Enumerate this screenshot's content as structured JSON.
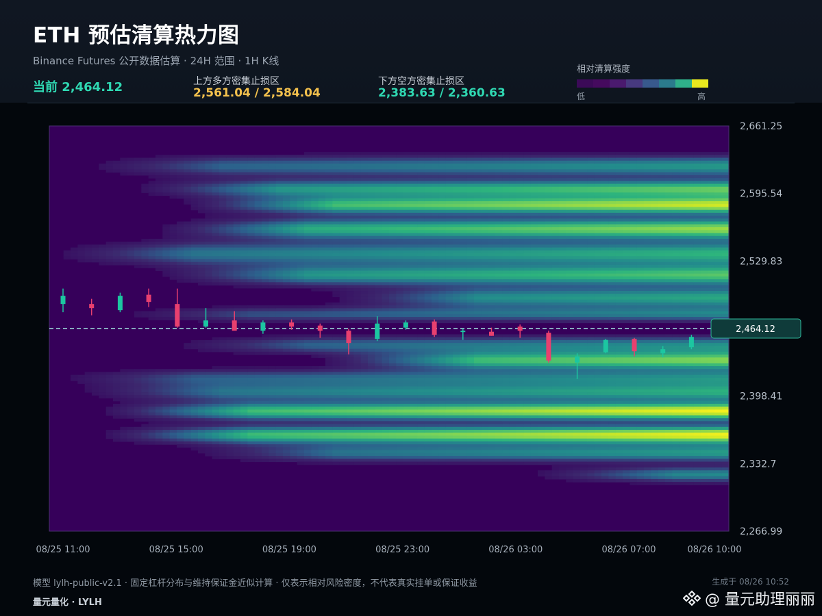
{
  "header": {
    "title": "ETH 预估清算热力图",
    "subtitle": "Binance Futures 公开数据估算 · 24H 范围 · 1H K线",
    "current_text": "当前 2,464.12",
    "upper_label": "上方多方密集止损区",
    "upper_value": "2,561.04 / 2,584.04",
    "lower_label": "下方空方密集止损区",
    "lower_value": "2,383.63 / 2,360.63"
  },
  "legend": {
    "title": "相对清算强度",
    "low": "低",
    "high": "高",
    "colors": [
      "#3b0a57",
      "#450a5e",
      "#4a1a6e",
      "#47397f",
      "#38598c",
      "#2b7b8d",
      "#2fb08a",
      "#e9e91f"
    ]
  },
  "footer": {
    "note": "模型 lylh-public-v2.1 · 固定杠杆分布与维持保证金近似计算 · 仅表示相对风险密度，不代表真实挂单或保证收益",
    "brand": "量元量化 · LYLH",
    "generated": "生成于 08/26 10:52",
    "watermark": "@ 量元助理丽丽",
    "watermark_icon": "binance-square-icon"
  },
  "colors": {
    "up": "#1cc6a1",
    "down": "#e8406f",
    "current_line": "#9fdfe0",
    "price_tag_bg": "#0f3b3a",
    "price_tag_border": "#2fb79a"
  },
  "chart_data": {
    "type": "heatmap",
    "title": "ETH 预估清算热力图",
    "ylim": [
      2266.99,
      2661.25
    ],
    "y_ticks": [
      2661.25,
      2595.54,
      2529.83,
      2464.12,
      2398.41,
      2332.7,
      2266.99
    ],
    "y_tick_labels": [
      "2,661.25",
      "2,595.54",
      "2,529.83",
      "2,464.12",
      "2,398.41",
      "2,332.7",
      "2,266.99"
    ],
    "x_ticks": [
      "08/25 11:00",
      "08/25 15:00",
      "08/25 19:00",
      "08/25 23:00",
      "08/26 03:00",
      "08/26 07:00",
      "08/26 10:00"
    ],
    "x_tick_positions": [
      0,
      4,
      8,
      12,
      16,
      20,
      23
    ],
    "current_price": 2464.12,
    "current_label": "2,464.12",
    "candles": [
      {
        "t": "08/25 11:00",
        "o": 2488,
        "c": 2496,
        "h": 2503,
        "l": 2480
      },
      {
        "t": "08/25 12:00",
        "o": 2488,
        "c": 2484,
        "h": 2493,
        "l": 2477
      },
      {
        "t": "08/25 13:00",
        "o": 2482,
        "c": 2496,
        "h": 2499,
        "l": 2480
      },
      {
        "t": "08/25 14:00",
        "o": 2497,
        "c": 2490,
        "h": 2503,
        "l": 2485
      },
      {
        "t": "08/25 15:00",
        "o": 2488,
        "c": 2466,
        "h": 2503,
        "l": 2465
      },
      {
        "t": "08/25 16:00",
        "o": 2466,
        "c": 2472,
        "h": 2484,
        "l": 2465
      },
      {
        "t": "08/25 17:00",
        "o": 2472,
        "c": 2462,
        "h": 2481,
        "l": 2465
      },
      {
        "t": "08/25 18:00",
        "o": 2462,
        "c": 2470,
        "h": 2472,
        "l": 2459
      },
      {
        "t": "08/25 19:00",
        "o": 2470,
        "c": 2466,
        "h": 2473,
        "l": 2463
      },
      {
        "t": "08/25 20:00",
        "o": 2467,
        "c": 2462,
        "h": 2469,
        "l": 2455
      },
      {
        "t": "08/25 21:00",
        "o": 2462,
        "c": 2450,
        "h": 2464,
        "l": 2439
      },
      {
        "t": "08/25 22:00",
        "o": 2454,
        "c": 2469,
        "h": 2476,
        "l": 2452
      },
      {
        "t": "08/25 23:00",
        "o": 2465,
        "c": 2470,
        "h": 2472,
        "l": 2463
      },
      {
        "t": "08/26 00:00",
        "o": 2471,
        "c": 2458,
        "h": 2473,
        "l": 2456
      },
      {
        "t": "08/26 01:00",
        "o": 2461,
        "c": 2462,
        "h": 2464,
        "l": 2453
      },
      {
        "t": "08/26 02:00",
        "o": 2461,
        "c": 2457,
        "h": 2465,
        "l": 2457
      },
      {
        "t": "08/26 03:00",
        "o": 2466,
        "c": 2462,
        "h": 2468,
        "l": 2455
      },
      {
        "t": "08/26 04:00",
        "o": 2460,
        "c": 2433,
        "h": 2462,
        "l": 2431
      },
      {
        "t": "08/26 05:00",
        "o": 2431,
        "c": 2437,
        "h": 2440,
        "l": 2415
      },
      {
        "t": "08/26 06:00",
        "o": 2441,
        "c": 2453,
        "h": 2454,
        "l": 2440
      },
      {
        "t": "08/26 07:00",
        "o": 2454,
        "c": 2442,
        "h": 2455,
        "l": 2437
      },
      {
        "t": "08/26 08:00",
        "o": 2440,
        "c": 2444,
        "h": 2447,
        "l": 2436
      },
      {
        "t": "08/26 09:00",
        "o": 2446,
        "c": 2456,
        "h": 2458,
        "l": 2444
      },
      {
        "t": "08/26 10:00",
        "o": 2458,
        "c": 2464.12,
        "h": 2465,
        "l": 2456
      }
    ],
    "bands": [
      {
        "center": 2622,
        "width": 7,
        "intensity": 0.55,
        "start": 2
      },
      {
        "center": 2600,
        "width": 6,
        "intensity": 0.75,
        "start": 4
      },
      {
        "center": 2584.04,
        "width": 6,
        "intensity": 0.92,
        "start": 6
      },
      {
        "center": 2561.04,
        "width": 7,
        "intensity": 0.85,
        "start": 5
      },
      {
        "center": 2537,
        "width": 8,
        "intensity": 0.65,
        "start": 1
      },
      {
        "center": 2516,
        "width": 7,
        "intensity": 0.72,
        "start": 5
      },
      {
        "center": 2494,
        "width": 7,
        "intensity": 0.6,
        "start": 11
      },
      {
        "center": 2478,
        "width": 5,
        "intensity": 0.45,
        "start": 3
      },
      {
        "center": 2448,
        "width": 6,
        "intensity": 0.5,
        "start": 5
      },
      {
        "center": 2433,
        "width": 6,
        "intensity": 0.8,
        "start": 11
      },
      {
        "center": 2416,
        "width": 6,
        "intensity": 0.5,
        "start": 1
      },
      {
        "center": 2402,
        "width": 6,
        "intensity": 0.6,
        "start": 2
      },
      {
        "center": 2383.63,
        "width": 6,
        "intensity": 1.0,
        "start": 3
      },
      {
        "center": 2360.63,
        "width": 6,
        "intensity": 1.0,
        "start": 3
      },
      {
        "center": 2343,
        "width": 6,
        "intensity": 0.55,
        "start": 6
      },
      {
        "center": 2322,
        "width": 5,
        "intensity": 0.5,
        "start": 18
      }
    ]
  }
}
